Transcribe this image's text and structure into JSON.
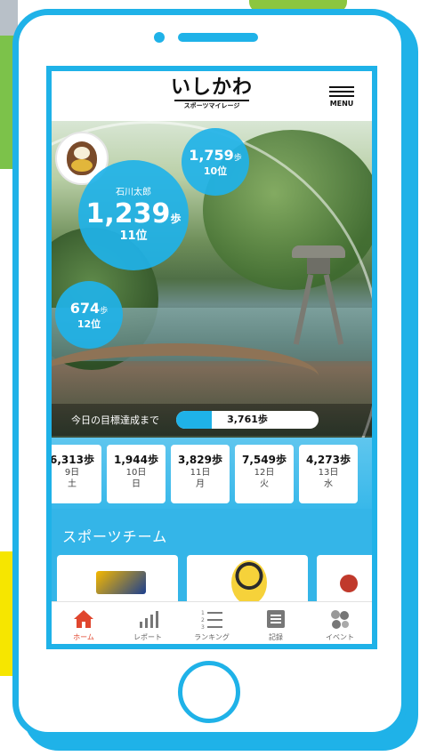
{
  "app": {
    "logo_main": "いしかわ",
    "logo_sub": "スポーツマイレージ",
    "menu_label": "MENU"
  },
  "ranking": {
    "user": {
      "name": "石川太郎",
      "steps": "1,239",
      "unit": "歩",
      "rank": "11位"
    },
    "above": {
      "steps": "1,759",
      "unit": "歩",
      "rank": "10位"
    },
    "below": {
      "steps": "674",
      "unit": "歩",
      "rank": "12位"
    }
  },
  "goal": {
    "label": "今日の目標達成まで",
    "remaining": "3,761歩",
    "progress_fraction": 0.25
  },
  "daily": [
    {
      "steps": "6,313歩",
      "date": "9日",
      "weekday": "土"
    },
    {
      "steps": "1,944歩",
      "date": "10日",
      "weekday": "日"
    },
    {
      "steps": "3,829歩",
      "date": "11日",
      "weekday": "月"
    },
    {
      "steps": "7,549歩",
      "date": "12日",
      "weekday": "火"
    },
    {
      "steps": "4,273歩",
      "date": "13日",
      "weekday": "水"
    }
  ],
  "sports": {
    "title": "スポーツチーム",
    "teams": [
      {
        "icon": "million-stars-logo"
      },
      {
        "icon": "bee-mascot-logo"
      },
      {
        "icon": "team-logo"
      }
    ]
  },
  "tabs": [
    {
      "label": "ホーム",
      "icon": "home-icon",
      "active": true
    },
    {
      "label": "レポート",
      "icon": "bar-chart-icon",
      "active": false
    },
    {
      "label": "ランキング",
      "icon": "ranking-list-icon",
      "active": false
    },
    {
      "label": "記録",
      "icon": "record-icon",
      "active": false
    },
    {
      "label": "イベント",
      "icon": "event-icon",
      "active": false
    }
  ],
  "colors": {
    "accent": "#1fb2e8",
    "active_tab": "#e0462e",
    "background_yellow": "#f6e600",
    "background_green": "#7cc24a"
  }
}
